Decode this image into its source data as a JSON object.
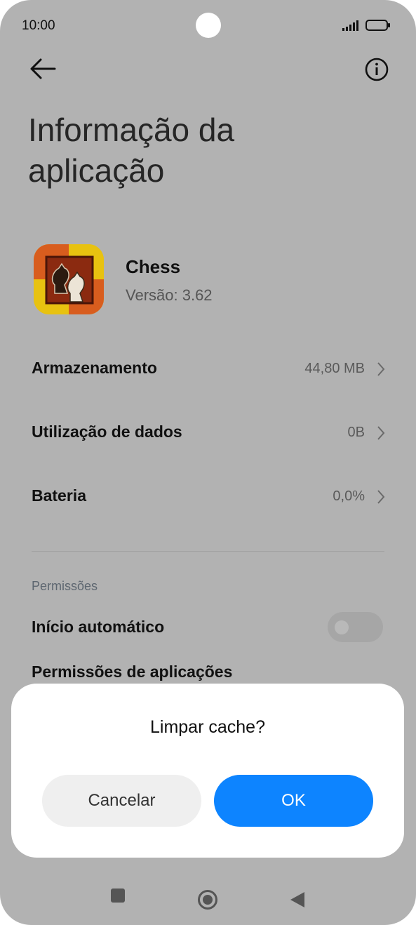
{
  "status_bar": {
    "time": "10:00"
  },
  "header": {
    "title": "Informação da aplicação"
  },
  "app": {
    "name": "Chess",
    "version": "Versão: 3.62"
  },
  "rows": [
    {
      "label": "Armazenamento",
      "value": "44,80 MB"
    },
    {
      "label": "Utilização de dados",
      "value": "0B"
    },
    {
      "label": "Bateria",
      "value": "0,0%"
    }
  ],
  "permissions": {
    "section_label": "Permissões",
    "autostart_label": "Início automático",
    "autostart_enabled": false,
    "app_permissions_label": "Permissões de aplicações"
  },
  "dialog": {
    "title": "Limpar cache?",
    "cancel_label": "Cancelar",
    "ok_label": "OK"
  },
  "colors": {
    "overlay_background": "#b2b2b2",
    "accent": "#0d84ff",
    "dialog_background": "#ffffff"
  }
}
